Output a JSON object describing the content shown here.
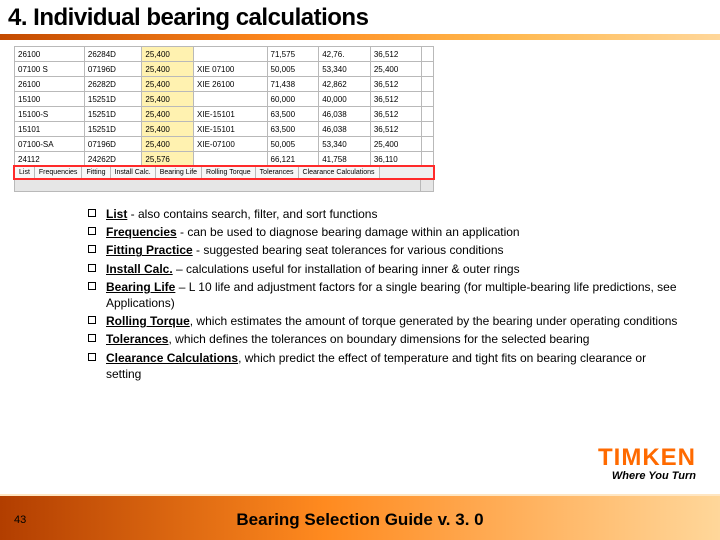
{
  "title": "4. Individual bearing calculations",
  "table": {
    "rows": [
      [
        "26100",
        "26284D",
        "25,400",
        "",
        "71,575",
        "42,76.",
        "36,512",
        ""
      ],
      [
        "07100 S",
        "07196D",
        "25,400",
        "XIE 07100",
        "50,005",
        "53,340",
        "25,400",
        ""
      ],
      [
        "26100",
        "26282D",
        "25,400",
        "XIE 26100",
        "71,438",
        "42,862",
        "36,512",
        ""
      ],
      [
        "15100",
        "15251D",
        "25,400",
        "",
        "60,000",
        "40,000",
        "36,512",
        ""
      ],
      [
        "15100-S",
        "15251D",
        "25,400",
        "XIE-15101",
        "63,500",
        "46,038",
        "36,512",
        ""
      ],
      [
        "15101",
        "15251D",
        "25,400",
        "XIE-15101",
        "63,500",
        "46,038",
        "36,512",
        ""
      ],
      [
        "07100-SA",
        "07196D",
        "25,400",
        "XIE-07100",
        "50,005",
        "53,340",
        "25,400",
        ""
      ],
      [
        "24112",
        "24262D",
        "25,576",
        "",
        "66,121",
        "41,758",
        "36,110",
        ""
      ]
    ]
  },
  "tabs": [
    "List",
    "Frequencies",
    "Fitting",
    "Install Calc.",
    "Bearing Life",
    "Rolling Torque",
    "Tolerances",
    "Clearance Calculations"
  ],
  "bullets": [
    {
      "head": "List",
      "tail": " - also contains search, filter, and sort functions"
    },
    {
      "head": "Frequencies",
      "tail": " - can be used to diagnose bearing damage within an application"
    },
    {
      "head": "Fitting Practice",
      "tail": " - suggested bearing seat tolerances for various conditions"
    },
    {
      "head": "Install Calc.",
      "tail": " – calculations useful for installation of bearing inner & outer rings"
    },
    {
      "head": "Bearing Life",
      "tail": " – L 10 life and adjustment factors for a single bearing (for multiple-bearing life predictions, see Applications)"
    },
    {
      "head": "Rolling Torque",
      "tail": ", which estimates the amount of torque generated by the bearing under operating conditions"
    },
    {
      "head": "Tolerances",
      "tail": ", which defines the tolerances on boundary dimensions for the selected bearing"
    },
    {
      "head": "Clearance Calculations",
      "tail": ", which predict the effect of temperature and tight fits on bearing clearance or setting"
    }
  ],
  "logo": "TIMKEN",
  "tagline": "Where You Turn",
  "page_number": "43",
  "footer_title": "Bearing Selection Guide v. 3. 0"
}
